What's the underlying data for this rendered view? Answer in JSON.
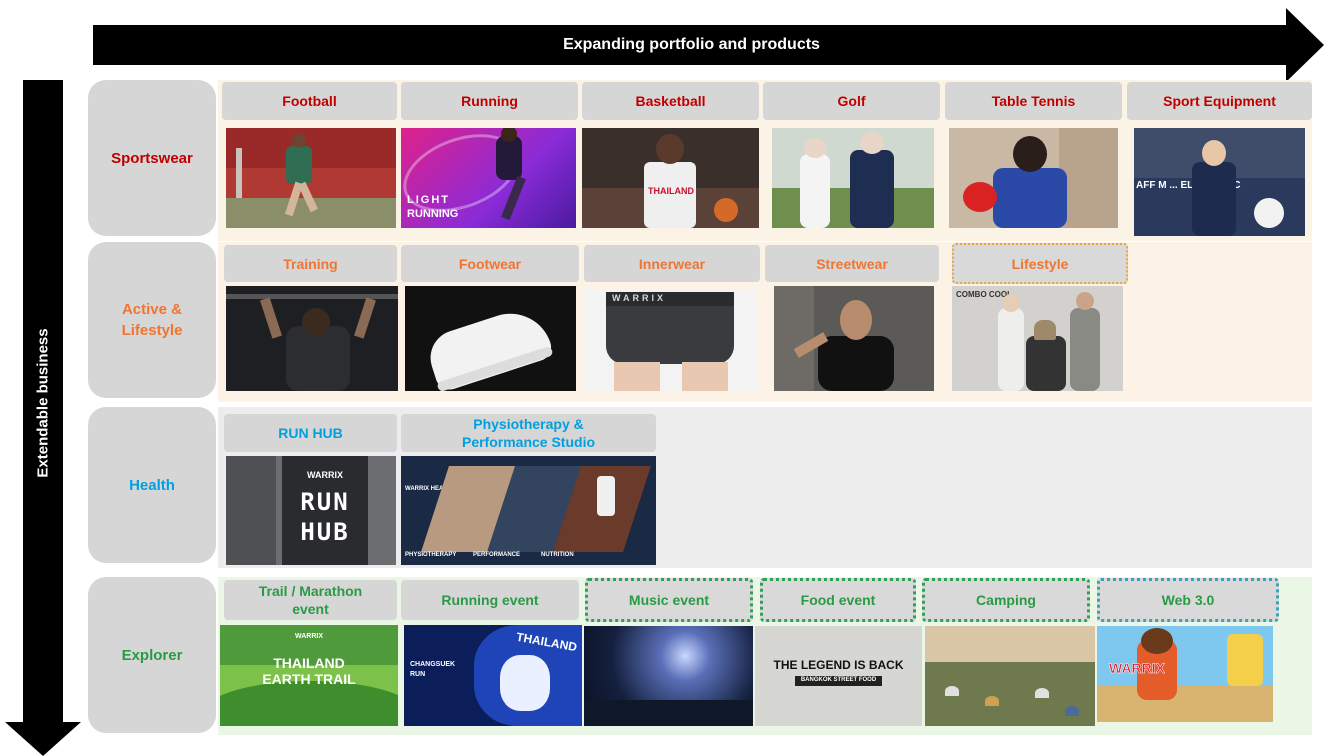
{
  "top_arrow": {
    "label": "Expanding portfolio and products"
  },
  "side_arrow": {
    "label": "Extendable business"
  },
  "rows": {
    "sportswear": {
      "label": "Sportswear",
      "categories": [
        "Football",
        "Running",
        "Basketball",
        "Golf",
        "Table Tennis",
        "Sport Equipment"
      ]
    },
    "active": {
      "label_line1": "Active &",
      "label_line2": "Lifestyle",
      "categories": [
        "Training",
        "Footwear",
        "Innerwear",
        "Streetwear",
        "Lifestyle"
      ]
    },
    "health": {
      "label": "Health",
      "categories": [
        "RUN HUB",
        "Physiotherapy &",
        "Performance Studio"
      ]
    },
    "explorer": {
      "label": "Explorer",
      "categories": [
        "Trail / Marathon",
        "event",
        "Running event",
        "Music event",
        "Food event",
        "Camping",
        "Web 3.0"
      ]
    }
  },
  "photo_text": {
    "running_l1": "LIGHT",
    "running_l2": "RUNNING",
    "basketball_jersey": "THAILAND",
    "sport_equipment_banner": "AFF M ... ELECTRIC C",
    "innerwear_band": "WARRIX",
    "lifestyle_sign": "COMBO COOL",
    "runhub_brand": "WARRIX",
    "runhub_l1": "RUN",
    "runhub_l2": "HUB",
    "physio_brand": "WARRIX HEALTH",
    "physio_tags": [
      "PHYSIOTHERAPY",
      "PERFORMANCE",
      "NUTRITION"
    ],
    "trail_brand": "WARRIX",
    "trail_l1": "THAILAND",
    "trail_l2": "EARTH TRAIL",
    "changsuek_l1": "CHANGSUEK",
    "changsuek_l2": "RUN",
    "changsuek_big": "THAILAND",
    "food_title": "THE LEGEND IS BACK",
    "food_sub": "BANGKOK STREET FOOD",
    "web3_title": "WARRIX"
  },
  "colors": {
    "sportswear": "#c00000",
    "active": "#f07531",
    "health": "#00a0e0",
    "explorer": "#2a9a45"
  }
}
